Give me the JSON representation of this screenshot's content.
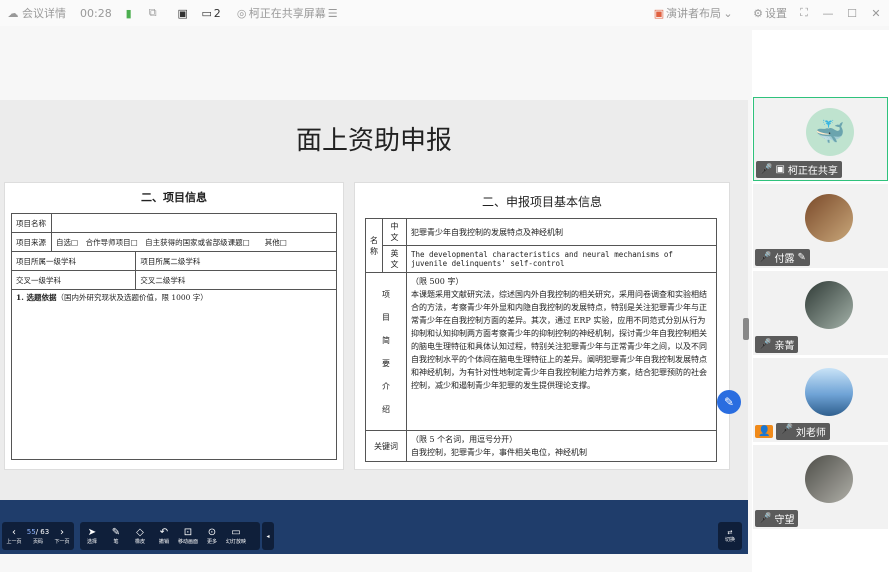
{
  "topbar": {
    "meeting_details": "会议详情",
    "timer": "00:28",
    "page_counter": "2",
    "sharing_status": "柯正在共享屏幕",
    "layout_label": "演讲者布局",
    "settings_label": "设置"
  },
  "slide": {
    "title": "面上资助申报"
  },
  "left_panel": {
    "heading": "二、项目信息",
    "rows": {
      "name_label": "项目名称",
      "source_label": "项目来源",
      "source_options": "自选□　合作导师项目□　自主获得的国家或省部级课题□　　其他□",
      "discipline1_label": "项目所属一级学科",
      "discipline2_label": "项目所属二级学科",
      "cross1_label": "交叉一级学科",
      "cross2_label": "交叉二级学科",
      "basis_label": "1. 选题依据",
      "basis_hint": "（国内外研究现状及选题价值，限 1000 字）"
    }
  },
  "right_panel": {
    "heading": "二、申报项目基本信息",
    "name_label": "名称",
    "cn_label": "中文",
    "cn_value": "犯罪青少年自我控制的发展特点及神经机制",
    "en_label": "英文",
    "en_value": "The developmental characteristics and neural mechanisms of juvenile delinquents' self-control",
    "summary_label": "项目简要介绍",
    "summary_limit": "（限 500 字）",
    "summary_text": "本课题采用文献研究法，综述国内外自我控制的相关研究，采用问卷调查和实验相结合的方法，考察青少年外显和内隐自我控制的发展特点，特别是关注犯罪青少年与正常青少年在自我控制方面的差异。其次，通过 ERP 实验，应用不同范式分别从行为抑制和认知抑制两方面考察青少年的抑制控制的神经机制，探讨青少年自我控制相关的脑电生理特征和具体认知过程，特别关注犯罪青少年与正常青少年之间，以及不同自我控制水平的个体间在脑电生理特征上的差异。阐明犯罪青少年自我控制发展特点和神经机制，为有针对性地制定青少年自我控制能力培养方案，结合犯罪预防的社会控制，减少和遏制青少年犯罪的发生提供理论支撑。",
    "keywords_label": "关键词",
    "keywords_limit": "（限 5 个名词，用逗号分开）",
    "keywords_value": "自我控制，犯罪青少年，事件相关电位，神经机制"
  },
  "toolbar": {
    "page_current": "55",
    "page_total": "/ 63",
    "prev_label": "上一页",
    "page_label": "页码",
    "next_label": "下一页",
    "tools": [
      "选择",
      "笔",
      "橡皮",
      "撤销",
      "移动画面",
      "更多",
      "幻灯放映"
    ],
    "collapse_label": "收起",
    "switch_label": "切换"
  },
  "participants": [
    {
      "name": "柯正在共享",
      "avatar": "whale-avatar",
      "color": "#bfe3cf"
    },
    {
      "name": "付露",
      "avatar": "bookshelf-avatar",
      "color": "#8a5a3a"
    },
    {
      "name": "亲菁",
      "avatar": "girl-avatar",
      "color": "#5e6a63"
    },
    {
      "name": "刘老师",
      "avatar": "sky-avatar",
      "color": "#6fa3d6"
    },
    {
      "name": "守望",
      "avatar": "rock-avatar",
      "color": "#7a7a74"
    }
  ]
}
